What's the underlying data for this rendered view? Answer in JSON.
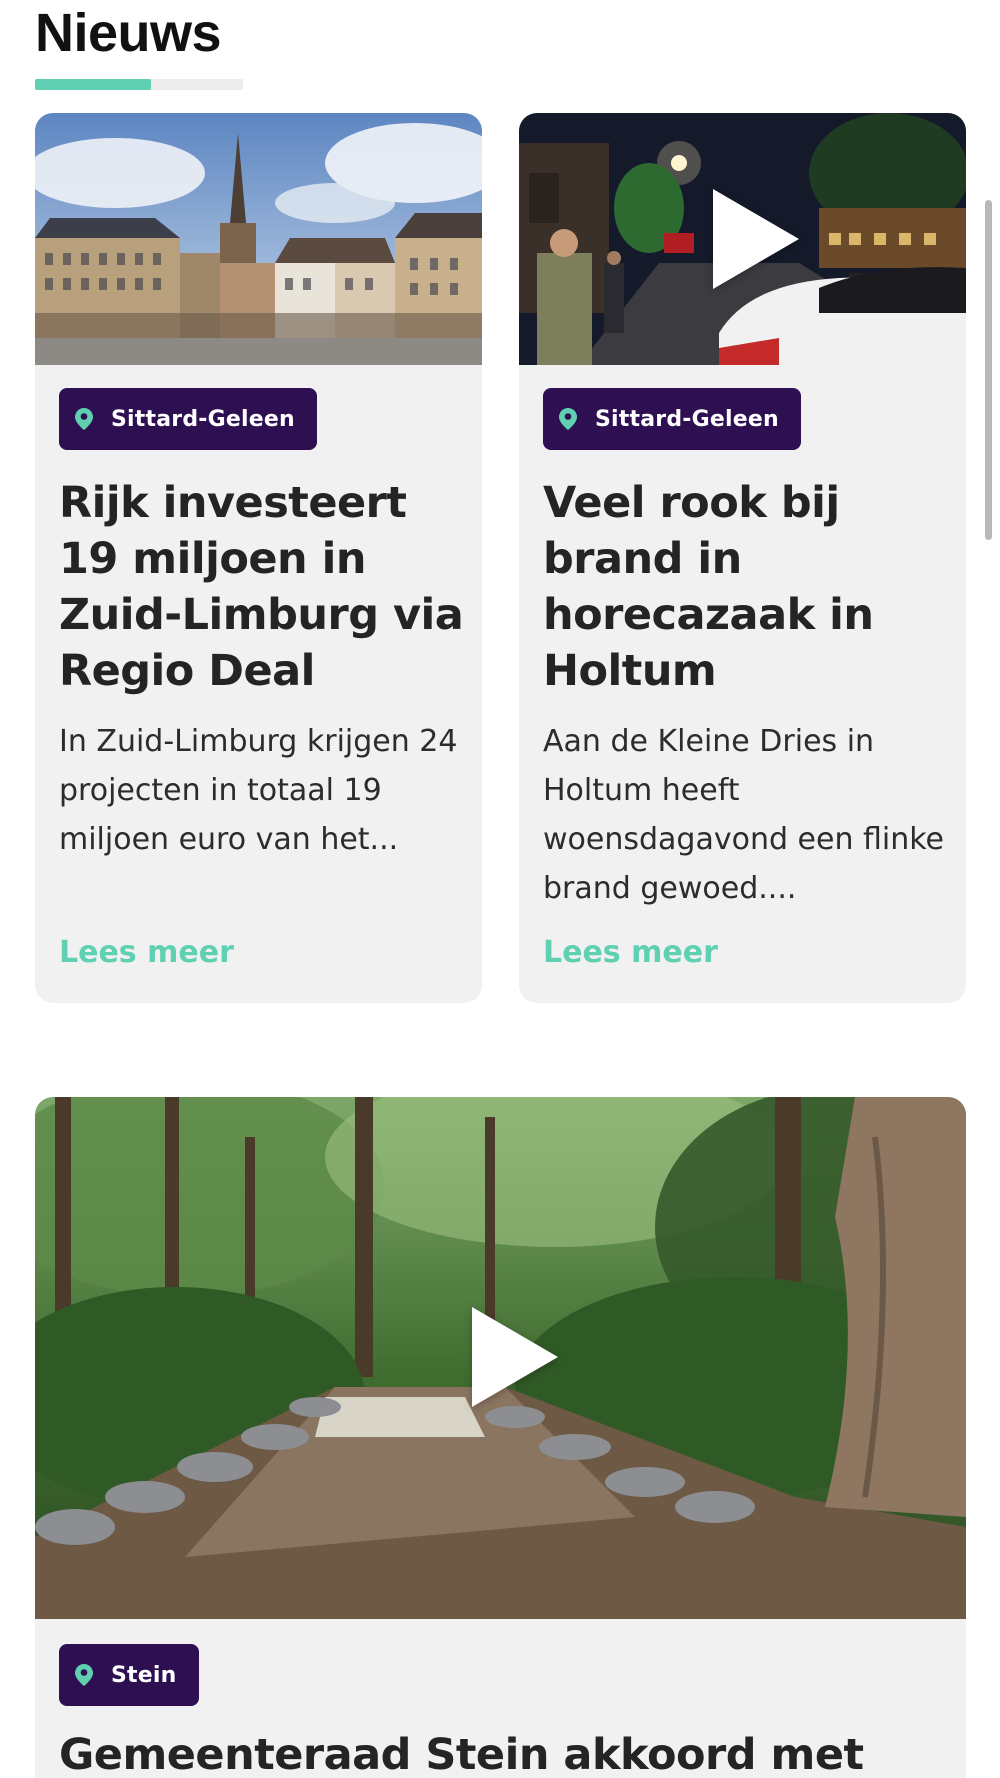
{
  "section": {
    "title": "Nieuws",
    "underline_progress": 0.56
  },
  "colors": {
    "accent": "#5fd0b2",
    "badge_bg": "#2d0f52",
    "card_bg": "#f1f1f2"
  },
  "articles": [
    {
      "location": "Sittard-Geleen",
      "location_icon": "location-pin-icon",
      "title": "Rijk investeert 19 miljoen in Zuid-Limburg via Regio Deal",
      "summary": "In Zuid-Limburg krijgen 24 projecten in totaal 19 miljoen euro van het...",
      "read_more": "Lees meer",
      "has_video": false
    },
    {
      "location": "Sittard-Geleen",
      "location_icon": "location-pin-icon",
      "title": "Veel rook bij brand in horecazaak in Holtum",
      "summary": "Aan de Kleine Dries in Holtum heeft woensdagavond een flinke brand gewoed....",
      "read_more": "Lees meer",
      "has_video": true,
      "video_icon": "play-icon"
    },
    {
      "location": "Stein",
      "location_icon": "location-pin-icon",
      "title": "Gemeenteraad Stein akkoord met",
      "has_video": true,
      "video_icon": "play-icon"
    }
  ]
}
